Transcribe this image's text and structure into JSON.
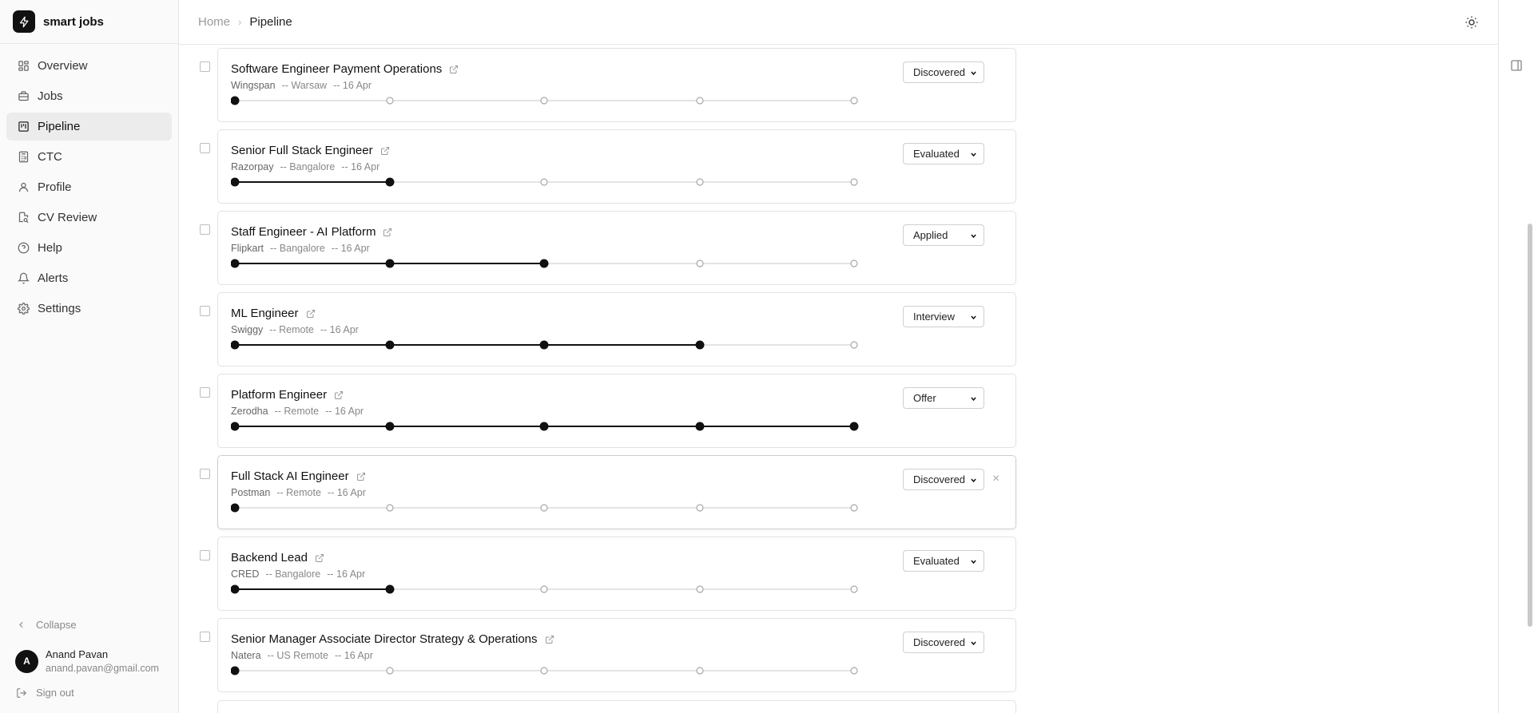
{
  "brand": {
    "name": "smart jobs",
    "icon": "bolt-icon"
  },
  "sidebar": {
    "items": [
      {
        "label": "Overview",
        "icon": "grid-icon"
      },
      {
        "label": "Jobs",
        "icon": "briefcase-icon"
      },
      {
        "label": "Pipeline",
        "icon": "kanban-icon",
        "active": true
      },
      {
        "label": "CTC",
        "icon": "calculator-icon"
      },
      {
        "label": "Profile",
        "icon": "user-icon"
      },
      {
        "label": "CV Review",
        "icon": "file-search-icon"
      },
      {
        "label": "Help",
        "icon": "help-circle-icon"
      },
      {
        "label": "Alerts",
        "icon": "bell-icon"
      },
      {
        "label": "Settings",
        "icon": "gear-icon"
      }
    ],
    "collapse_label": "Collapse",
    "user": {
      "initial": "A",
      "name": "Anand Pavan",
      "email": "anand.pavan@gmail.com"
    },
    "signout_label": "Sign out"
  },
  "header": {
    "breadcrumb": {
      "home": "Home",
      "separator": "›",
      "current": "Pipeline"
    }
  },
  "pipeline": {
    "stages": [
      "Discovered",
      "Evaluated",
      "Applied",
      "Interview",
      "Offer"
    ],
    "jobs": [
      {
        "title": "Software Engineer Payment Operations",
        "company": "Wingspan",
        "location": "-- Warsaw",
        "date": "-- 16 Apr",
        "status": "Discovered",
        "progress": 1
      },
      {
        "title": "Senior Full Stack Engineer",
        "company": "Razorpay",
        "location": "-- Bangalore",
        "date": "-- 16 Apr",
        "status": "Evaluated",
        "progress": 2
      },
      {
        "title": "Staff Engineer - AI Platform",
        "company": "Flipkart",
        "location": "-- Bangalore",
        "date": "-- 16 Apr",
        "status": "Applied",
        "progress": 3
      },
      {
        "title": "ML Engineer",
        "company": "Swiggy",
        "location": "-- Remote",
        "date": "-- 16 Apr",
        "status": "Interview",
        "progress": 4
      },
      {
        "title": "Platform Engineer",
        "company": "Zerodha",
        "location": "-- Remote",
        "date": "-- 16 Apr",
        "status": "Offer",
        "progress": 5
      },
      {
        "title": "Full Stack AI Engineer",
        "company": "Postman",
        "location": "-- Remote",
        "date": "-- 16 Apr",
        "status": "Discovered",
        "progress": 1,
        "hovered": true,
        "remove_label": "×"
      },
      {
        "title": "Backend Lead",
        "company": "CRED",
        "location": "-- Bangalore",
        "date": "-- 16 Apr",
        "status": "Evaluated",
        "progress": 2
      },
      {
        "title": "Senior Manager Associate Director Strategy & Operations",
        "company": "Natera",
        "location": "-- US Remote",
        "date": "-- 16 Apr",
        "status": "Discovered",
        "progress": 1
      }
    ]
  },
  "colors": {
    "accent": "#111111",
    "muted": "#888888",
    "border": "#e2e2e2",
    "track": "#d4d4d4"
  }
}
